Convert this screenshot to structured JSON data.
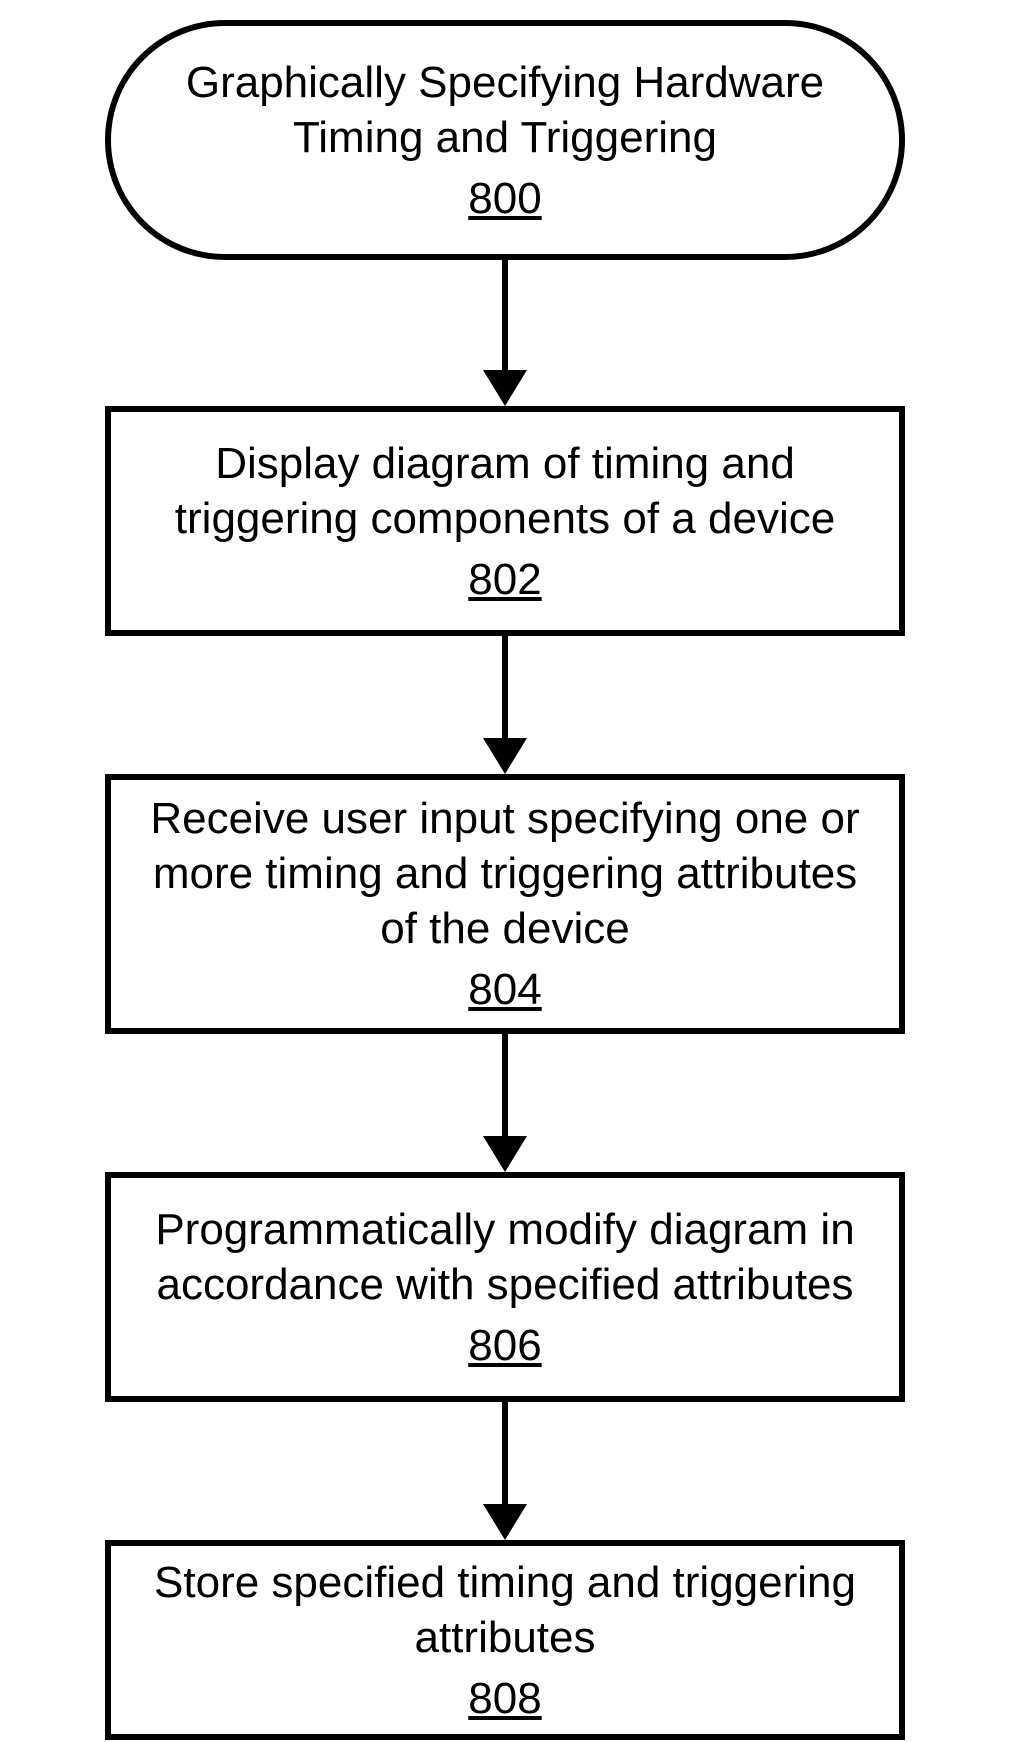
{
  "flow": {
    "start": {
      "text": "Graphically Specifying Hardware Timing and Triggering",
      "ref": "800"
    },
    "steps": [
      {
        "text": "Display diagram of timing and triggering components of a device",
        "ref": "802"
      },
      {
        "text": "Receive user input specifying one or more timing and triggering attributes of the device",
        "ref": "804"
      },
      {
        "text": "Programmatically modify diagram in accordance with specified attributes",
        "ref": "806"
      },
      {
        "text": "Store specified timing and triggering attributes",
        "ref": "808"
      }
    ]
  }
}
